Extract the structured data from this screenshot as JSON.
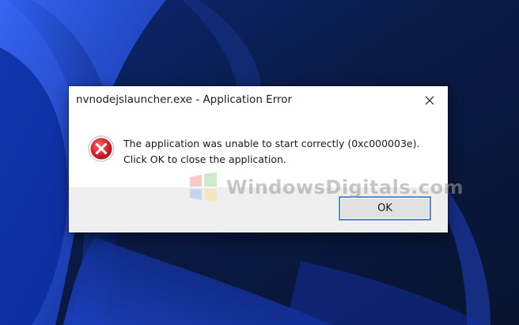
{
  "dialog": {
    "title": "nvnodejslauncher.exe - Application Error",
    "message": "The application was unable to start correctly (0xc000003e). Click OK to close the application.",
    "ok_label": "OK",
    "icon": "error-icon"
  },
  "watermark": {
    "text": "WindowsDigitals.com"
  },
  "colors": {
    "desktop_dark": "#0a1c4a",
    "desktop_accent": "#1f4bd8",
    "error_red": "#d9232b",
    "footer_bg": "#efefef",
    "button_border": "#2b6cc4"
  }
}
